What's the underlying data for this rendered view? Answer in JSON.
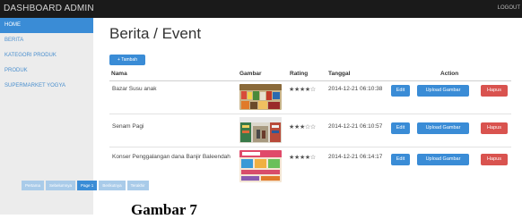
{
  "app": {
    "title": "DASHBOARD ADMIN",
    "logout_label": "LOGOUT"
  },
  "sidebar": {
    "items": [
      {
        "label": "HOME",
        "active": true
      },
      {
        "label": "BERITA",
        "active": false
      },
      {
        "label": "KATEGORI PRODUK",
        "active": false
      },
      {
        "label": "PRODUK",
        "active": false
      },
      {
        "label": "SUPERMARKET YOGYA",
        "active": false
      }
    ]
  },
  "main": {
    "title": "Berita / Event",
    "add_label": "+ Tambah",
    "columns": {
      "name": "Nama",
      "image": "Gambar",
      "rating": "Rating",
      "date": "Tanggal",
      "action": "Action"
    },
    "rows": [
      {
        "name": "Bazar Susu anak",
        "image_icon": "grocery-shelf-photo",
        "rating": "★★★★☆",
        "date": "2014-12-21 06:10:38"
      },
      {
        "name": "Senam Pagi",
        "image_icon": "supermarket-aisle-photo",
        "rating": "★★★☆☆",
        "date": "2014-12-21 06:10:57"
      },
      {
        "name": "Konser Penggalangan dana Banjir Baleendah",
        "image_icon": "event-poster-photo",
        "rating": "★★★★☆",
        "date": "2014-12-21 06:14:17"
      }
    ],
    "row_actions": {
      "edit": "Edit",
      "upload": "Upload Gambar",
      "delete": "Hapus"
    }
  },
  "pagination": {
    "first": "Pertama",
    "prev": "Sebelumnya",
    "current": "Page 1",
    "next": "Berikutnya",
    "last": "Terakhir"
  },
  "caption": "Gambar 7",
  "colors": {
    "topbar": "#1a1a1a",
    "accent": "#3a8cd6",
    "danger": "#d9534f",
    "sidebar": "#ececec"
  }
}
